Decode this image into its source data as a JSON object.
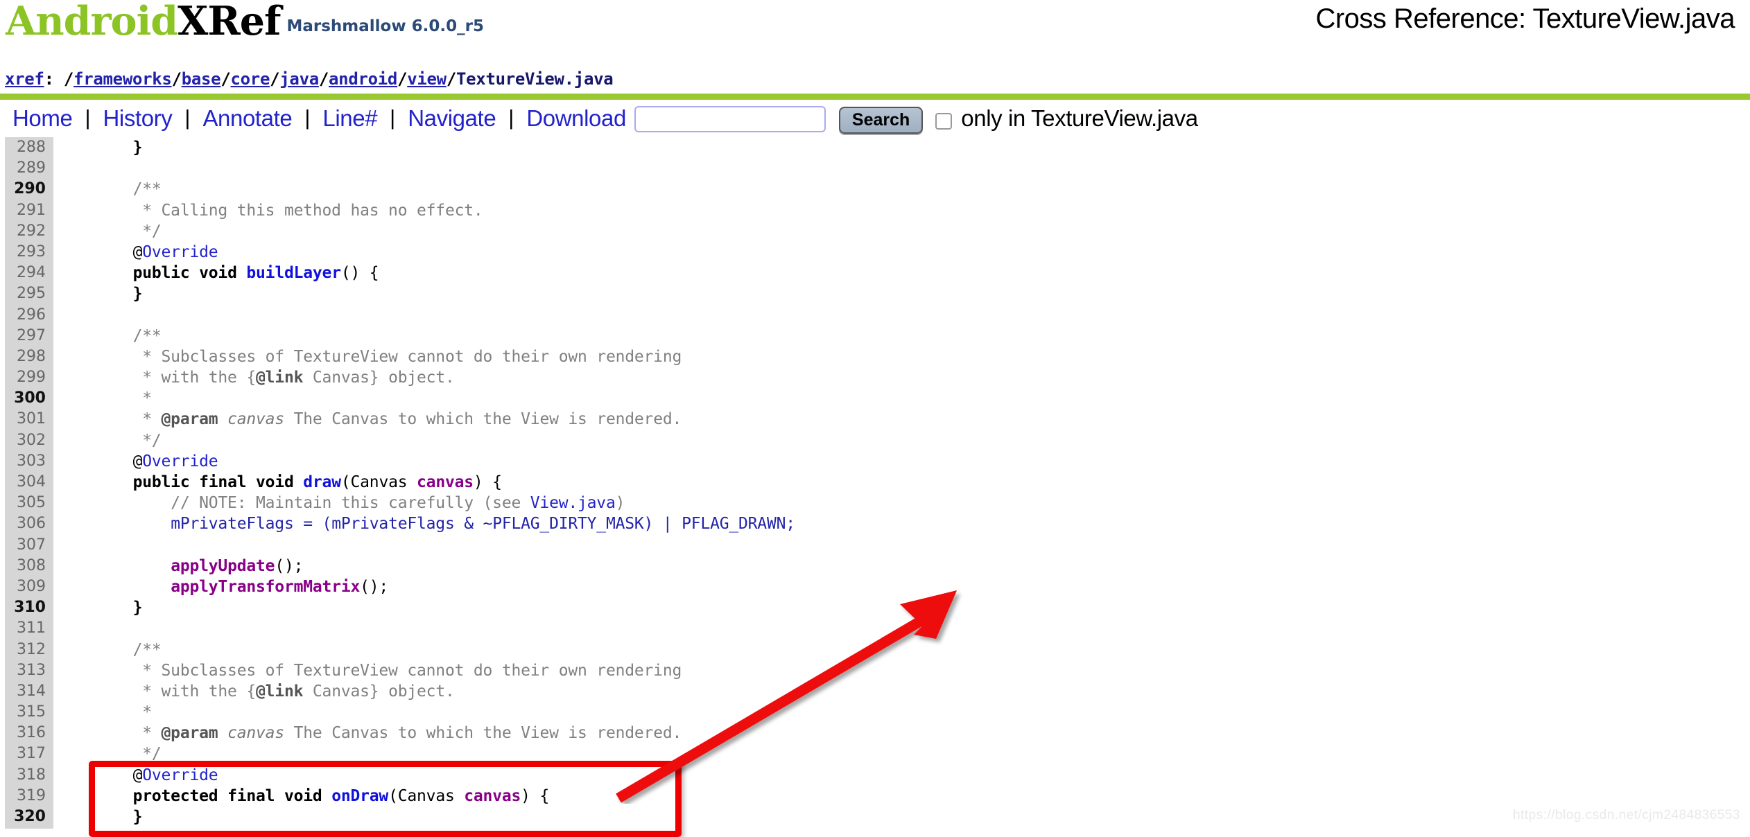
{
  "header": {
    "logo_android": "Android",
    "logo_xref": "XRef",
    "version": "Marshmallow 6.0.0_r5",
    "page_title": "Cross Reference: TextureView.java",
    "xref_label": "xref",
    "xref_colon": ": ",
    "xref_segments": [
      "frameworks",
      "base",
      "core",
      "java",
      "android",
      "view"
    ],
    "xref_leaf": "TextureView.java",
    "accent_green": "#9ac830",
    "link_blue": "#2222cc"
  },
  "menu": {
    "items": [
      {
        "label": "Home"
      },
      {
        "label": "History"
      },
      {
        "label": "Annotate"
      },
      {
        "label": "Line#"
      },
      {
        "label": "Navigate"
      },
      {
        "label": "Download"
      }
    ],
    "separator": "|",
    "search_value": "",
    "search_placeholder": "",
    "search_button_label": "Search",
    "only_in_label": "only in TextureView.java",
    "only_in_checked": false
  },
  "code": {
    "first_line": 288,
    "lines": [
      {
        "n": 288,
        "tokens": [
          {
            "t": "    ",
            "c": "plain"
          },
          {
            "t": "}",
            "c": "kw"
          }
        ]
      },
      {
        "n": 289,
        "tokens": []
      },
      {
        "n": 290,
        "tokens": [
          {
            "t": "    /**",
            "c": "cm"
          }
        ]
      },
      {
        "n": 291,
        "tokens": [
          {
            "t": "     * Calling this method has no effect.",
            "c": "cm"
          }
        ]
      },
      {
        "n": 292,
        "tokens": [
          {
            "t": "     */",
            "c": "cm"
          }
        ]
      },
      {
        "n": 293,
        "tokens": [
          {
            "t": "    ",
            "c": "plain"
          },
          {
            "t": "@",
            "c": "at"
          },
          {
            "t": "Override",
            "c": "anno"
          }
        ]
      },
      {
        "n": 294,
        "tokens": [
          {
            "t": "    ",
            "c": "plain"
          },
          {
            "t": "public void ",
            "c": "kw"
          },
          {
            "t": "buildLayer",
            "c": "mth"
          },
          {
            "t": "() {",
            "c": "plain"
          }
        ]
      },
      {
        "n": 295,
        "tokens": [
          {
            "t": "    ",
            "c": "plain"
          },
          {
            "t": "}",
            "c": "kw"
          }
        ]
      },
      {
        "n": 296,
        "tokens": []
      },
      {
        "n": 297,
        "tokens": [
          {
            "t": "    /**",
            "c": "cm"
          }
        ]
      },
      {
        "n": 298,
        "tokens": [
          {
            "t": "     * Subclasses of TextureView cannot do their own rendering",
            "c": "cm"
          }
        ]
      },
      {
        "n": 299,
        "tokens": [
          {
            "t": "     * with the {",
            "c": "cm"
          },
          {
            "t": "@link",
            "c": "cmb"
          },
          {
            "t": " Canvas} object.",
            "c": "cm"
          }
        ]
      },
      {
        "n": 300,
        "tokens": [
          {
            "t": "     *",
            "c": "cm"
          }
        ]
      },
      {
        "n": 301,
        "tokens": [
          {
            "t": "     * ",
            "c": "cm"
          },
          {
            "t": "@param",
            "c": "cmb"
          },
          {
            "t": " ",
            "c": "cm"
          },
          {
            "t": "canvas",
            "c": "cmi"
          },
          {
            "t": " The Canvas to which the View is rendered.",
            "c": "cm"
          }
        ]
      },
      {
        "n": 302,
        "tokens": [
          {
            "t": "     */",
            "c": "cm"
          }
        ]
      },
      {
        "n": 303,
        "tokens": [
          {
            "t": "    ",
            "c": "plain"
          },
          {
            "t": "@",
            "c": "at"
          },
          {
            "t": "Override",
            "c": "anno"
          }
        ]
      },
      {
        "n": 304,
        "tokens": [
          {
            "t": "    ",
            "c": "plain"
          },
          {
            "t": "public final void ",
            "c": "kw"
          },
          {
            "t": "draw",
            "c": "mth"
          },
          {
            "t": "(",
            "c": "plain"
          },
          {
            "t": "Canvas ",
            "c": "typ"
          },
          {
            "t": "canvas",
            "c": "mthp"
          },
          {
            "t": ") {",
            "c": "plain"
          }
        ]
      },
      {
        "n": 305,
        "tokens": [
          {
            "t": "        // NOTE: Maintain this carefully (see ",
            "c": "cm"
          },
          {
            "t": "View.java",
            "c": "lnk"
          },
          {
            "t": ")",
            "c": "cm"
          }
        ]
      },
      {
        "n": 306,
        "tokens": [
          {
            "t": "        ",
            "c": "plain"
          },
          {
            "t": "mPrivateFlags = (mPrivateFlags & ~PFLAG_DIRTY_MASK) | PFLAG_DRAWN;",
            "c": "var"
          }
        ]
      },
      {
        "n": 307,
        "tokens": []
      },
      {
        "n": 308,
        "tokens": [
          {
            "t": "        ",
            "c": "plain"
          },
          {
            "t": "applyUpdate",
            "c": "mthp"
          },
          {
            "t": "();",
            "c": "plain"
          }
        ]
      },
      {
        "n": 309,
        "tokens": [
          {
            "t": "        ",
            "c": "plain"
          },
          {
            "t": "applyTransformMatrix",
            "c": "mthp"
          },
          {
            "t": "();",
            "c": "plain"
          }
        ]
      },
      {
        "n": 310,
        "tokens": [
          {
            "t": "    ",
            "c": "plain"
          },
          {
            "t": "}",
            "c": "kw"
          }
        ]
      },
      {
        "n": 311,
        "tokens": []
      },
      {
        "n": 312,
        "tokens": [
          {
            "t": "    /**",
            "c": "cm"
          }
        ]
      },
      {
        "n": 313,
        "tokens": [
          {
            "t": "     * Subclasses of TextureView cannot do their own rendering",
            "c": "cm"
          }
        ]
      },
      {
        "n": 314,
        "tokens": [
          {
            "t": "     * with the {",
            "c": "cm"
          },
          {
            "t": "@link",
            "c": "cmb"
          },
          {
            "t": " Canvas} object.",
            "c": "cm"
          }
        ]
      },
      {
        "n": 315,
        "tokens": [
          {
            "t": "     *",
            "c": "cm"
          }
        ]
      },
      {
        "n": 316,
        "tokens": [
          {
            "t": "     * ",
            "c": "cm"
          },
          {
            "t": "@param",
            "c": "cmb"
          },
          {
            "t": " ",
            "c": "cm"
          },
          {
            "t": "canvas",
            "c": "cmi"
          },
          {
            "t": " The Canvas to which the View is rendered.",
            "c": "cm"
          }
        ]
      },
      {
        "n": 317,
        "tokens": [
          {
            "t": "     */",
            "c": "cm"
          }
        ]
      },
      {
        "n": 318,
        "tokens": [
          {
            "t": "    ",
            "c": "plain"
          },
          {
            "t": "@",
            "c": "at"
          },
          {
            "t": "Override",
            "c": "anno"
          }
        ]
      },
      {
        "n": 319,
        "tokens": [
          {
            "t": "    ",
            "c": "plain"
          },
          {
            "t": "protected final void ",
            "c": "kw"
          },
          {
            "t": "onDraw",
            "c": "mth"
          },
          {
            "t": "(",
            "c": "plain"
          },
          {
            "t": "Canvas ",
            "c": "typ"
          },
          {
            "t": "canvas",
            "c": "mthp"
          },
          {
            "t": ") {",
            "c": "plain"
          }
        ]
      },
      {
        "n": 320,
        "tokens": [
          {
            "t": "    ",
            "c": "plain"
          },
          {
            "t": "}",
            "c": "kw"
          }
        ]
      }
    ]
  },
  "annotations": {
    "highlight_color": "#ee0000",
    "highlight_lines": "318-320",
    "arrow_direction": "up-right"
  },
  "watermark": {
    "text": "https://blog.csdn.net/cjm2484836553"
  }
}
